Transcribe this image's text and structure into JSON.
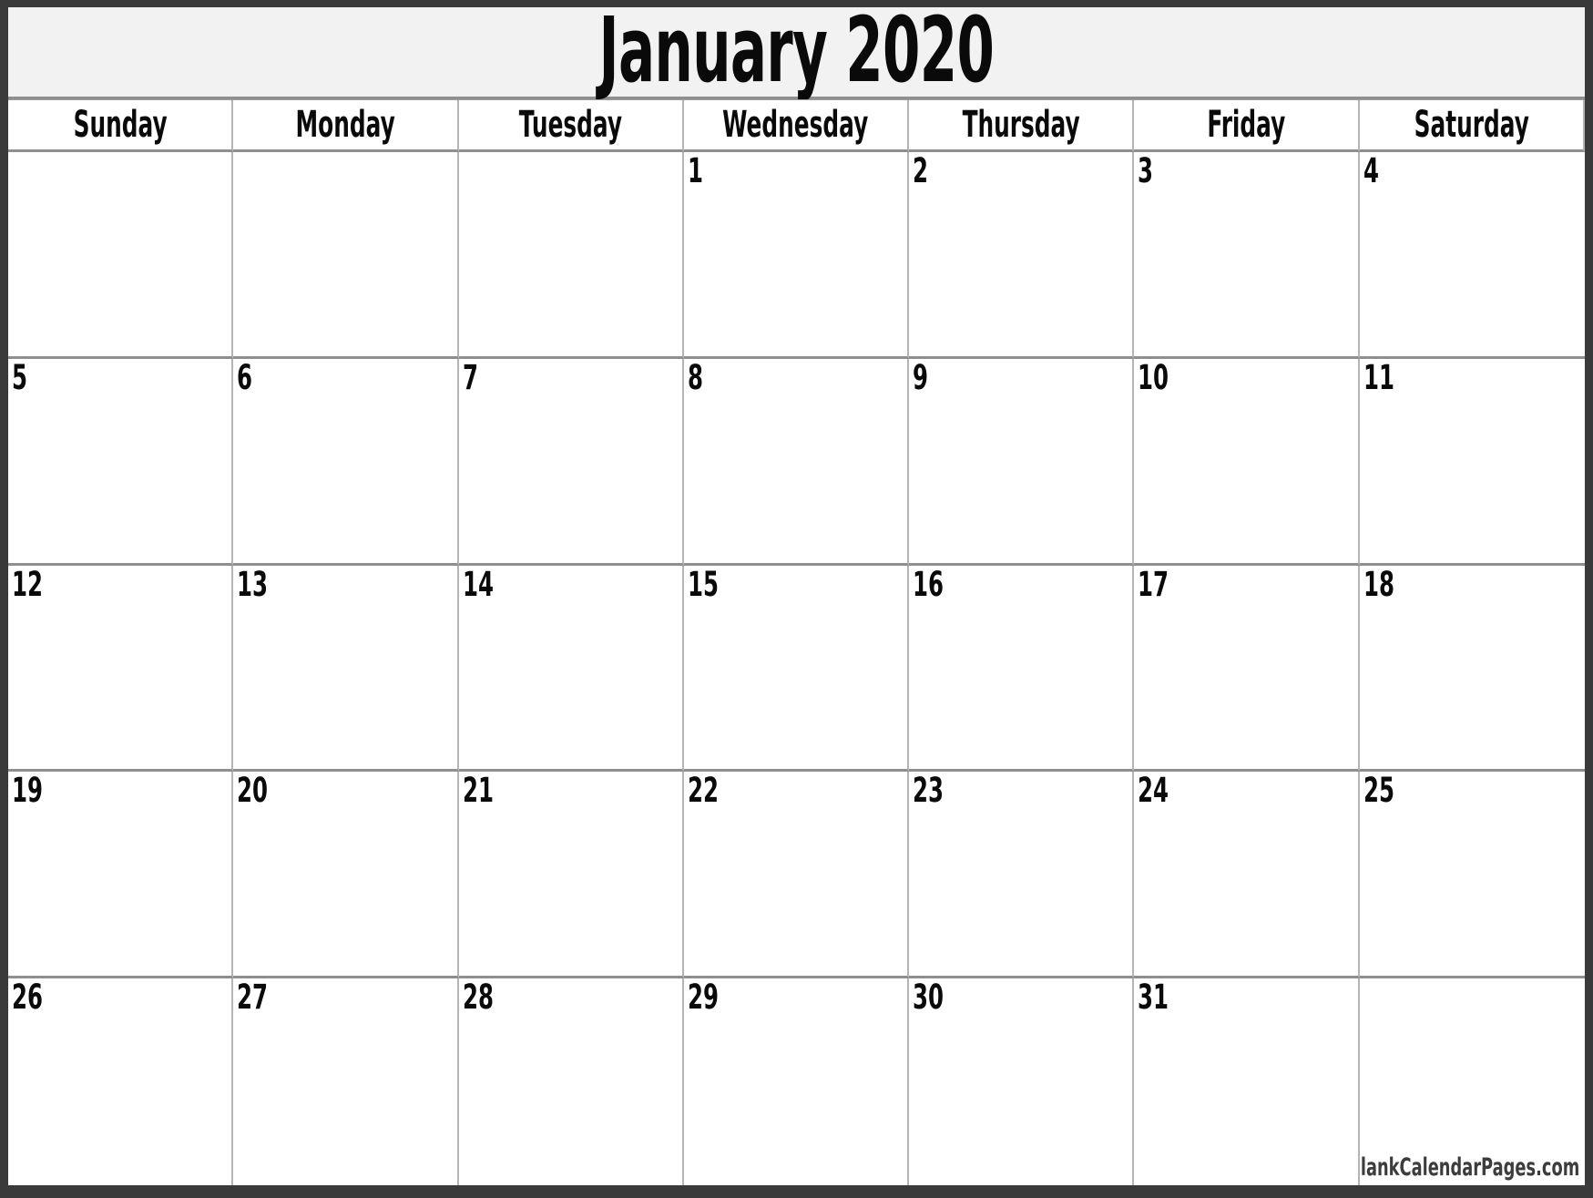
{
  "calendar": {
    "title": "January 2020",
    "month": "January",
    "year": "2020",
    "weekdays": [
      "Sunday",
      "Monday",
      "Tuesday",
      "Wednesday",
      "Thursday",
      "Friday",
      "Saturday"
    ],
    "weeks": [
      [
        "",
        "",
        "",
        "1",
        "2",
        "3",
        "4"
      ],
      [
        "5",
        "6",
        "7",
        "8",
        "9",
        "10",
        "11"
      ],
      [
        "12",
        "13",
        "14",
        "15",
        "16",
        "17",
        "18"
      ],
      [
        "19",
        "20",
        "21",
        "22",
        "23",
        "24",
        "25"
      ],
      [
        "26",
        "27",
        "28",
        "29",
        "30",
        "31",
        ""
      ]
    ],
    "credit": "© BlankCalendarPages.com",
    "colors": {
      "frame": "#3a3a3a",
      "title_background": "#f2f2f2",
      "grid_line": "#b4b4b4",
      "row_line": "#8f8f8f",
      "text": "#0a0a0a",
      "credit_text": "#3c3c3c",
      "cell_background": "#ffffff"
    }
  }
}
